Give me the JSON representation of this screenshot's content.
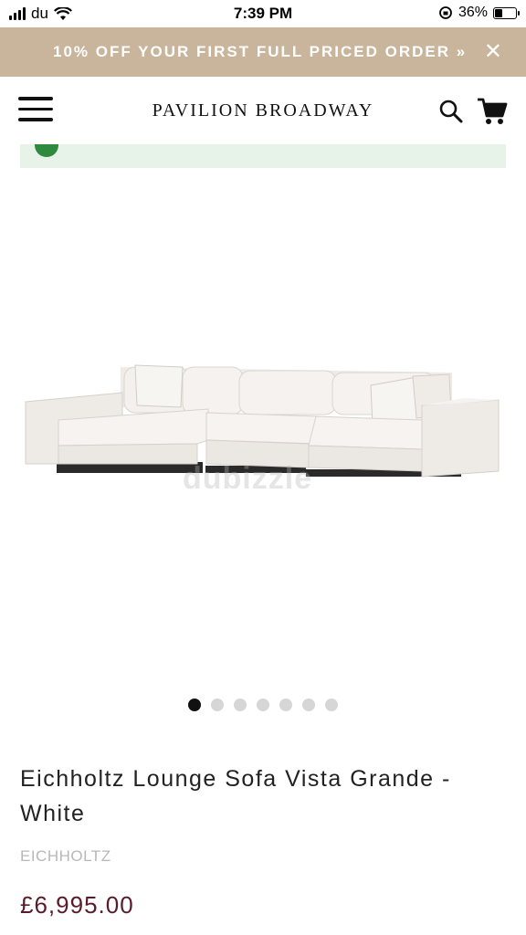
{
  "status_bar": {
    "carrier": "du",
    "time": "7:39 PM",
    "battery_percent": "36%",
    "battery_level": 0.36
  },
  "promo": {
    "text": "10% OFF YOUR FIRST FULL PRICED ORDER »",
    "close": "✕"
  },
  "header": {
    "brand": "PAVILION BROADWAY"
  },
  "gallery": {
    "watermark": "dubizzle",
    "slide_count": 7,
    "active_slide": 1
  },
  "product": {
    "title": "Eichholtz Lounge Sofa Vista Grande - White",
    "vendor": "EICHHOLTZ",
    "price": "£6,995.00"
  },
  "colors": {
    "promo_bg": "#c9b59b",
    "notice_bg": "#e7f3e8",
    "price": "#5a1b2b"
  }
}
